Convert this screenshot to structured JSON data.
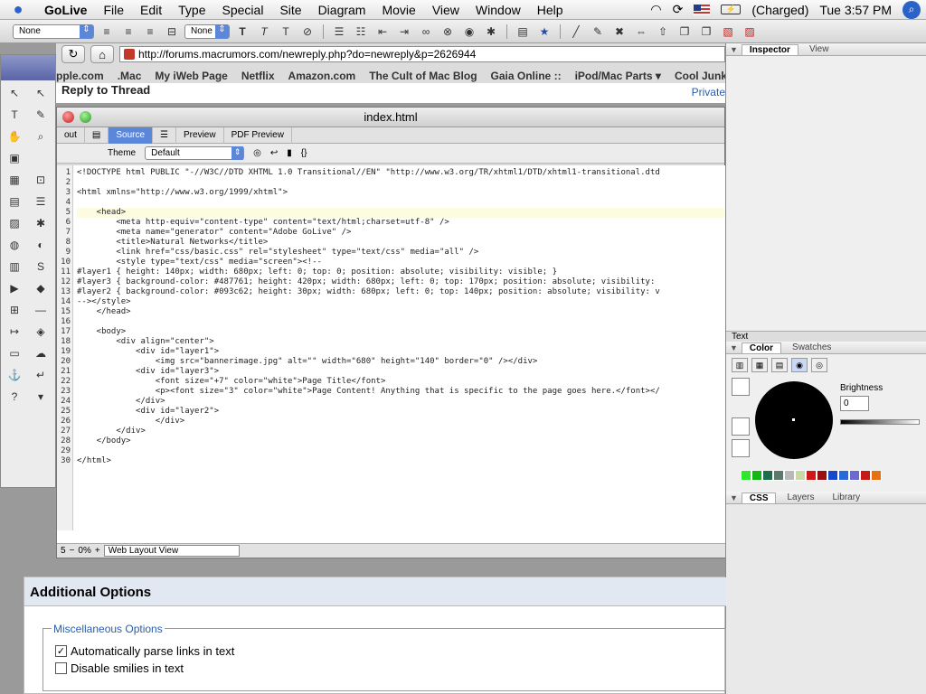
{
  "menubar": {
    "app_name": "GoLive",
    "items": [
      "File",
      "Edit",
      "Type",
      "Special",
      "Site",
      "Diagram",
      "Movie",
      "View",
      "Window",
      "Help"
    ],
    "battery_status": "(Charged)",
    "clock": "Tue 3:57 PM"
  },
  "toolbar": {
    "style_select": "None",
    "font_select": "None"
  },
  "browser": {
    "url": "http://forums.macrumors.com/newreply.php?do=newreply&p=2626944",
    "bookmarks": [
      "pple.com",
      ".Mac",
      "My iWeb Page",
      "Netflix",
      "Amazon.com",
      "The Cult of Mac Blog",
      "Gaia Online ::",
      "iPod/Mac Parts ▾",
      "Cool Junk ▾"
    ],
    "page_heading": "Reply to Thread",
    "private_tab": "Private"
  },
  "document": {
    "title": "index.html",
    "tabs": [
      "out",
      "Source",
      "Preview",
      "PDF Preview"
    ],
    "theme_label": "Theme",
    "theme_value": "Default",
    "braces_label": "{}",
    "line_numbers": [
      "1",
      "2",
      "3",
      "4",
      "5",
      "6",
      "7",
      "8",
      "9",
      "10",
      "11",
      "12",
      "13",
      "14",
      "15",
      "16",
      "17",
      "18",
      "19",
      "20",
      "21",
      "22",
      "23",
      "24",
      "25",
      "26",
      "27",
      "28",
      "29",
      "30"
    ],
    "code_lines": [
      "<!DOCTYPE html PUBLIC \"-//W3C//DTD XHTML 1.0 Transitional//EN\" \"http://www.w3.org/TR/xhtml1/DTD/xhtml1-transitional.dtd",
      "",
      "<html xmlns=\"http://www.w3.org/1999/xhtml\">",
      "",
      "    <head>",
      "        <meta http-equiv=\"content-type\" content=\"text/html;charset=utf-8\" />",
      "        <meta name=\"generator\" content=\"Adobe GoLive\" />",
      "        <title>Natural Networks</title>",
      "        <link href=\"css/basic.css\" rel=\"stylesheet\" type=\"text/css\" media=\"all\" />",
      "        <style type=\"text/css\" media=\"screen\"><!--",
      "#layer1 { height: 140px; width: 680px; left: 0; top: 0; position: absolute; visibility: visible; }",
      "#layer3 { background-color: #487761; height: 420px; width: 680px; left: 0; top: 170px; position: absolute; visibility:",
      "#layer2 { background-color: #093c62; height: 30px; width: 680px; left: 0; top: 140px; position: absolute; visibility: v",
      "--></style>",
      "    </head>",
      "",
      "    <body>",
      "        <div align=\"center\">",
      "            <div id=\"layer1\">",
      "                <img src=\"bannerimage.jpg\" alt=\"\" width=\"680\" height=\"140\" border=\"0\" /></div>",
      "            <div id=\"layer3\">",
      "                <font size=\"+7\" color=\"white\">Page Title</font>",
      "                <p><font size=\"3\" color=\"white\">Page Content! Anything that is specific to the page goes here.</font></",
      "            </div>",
      "            <div id=\"layer2\">",
      "                </div>",
      "        </div>",
      "    </body>",
      "",
      "</html>"
    ],
    "cursor_line": "5",
    "zoom": "0%",
    "view_mode": "Web Layout View"
  },
  "inspector": {
    "tabs": [
      "Inspector",
      "View"
    ],
    "text_label": "Text",
    "color_tabs": [
      "Color",
      "Swatches"
    ],
    "brightness_label": "Brightness",
    "brightness_value": "0",
    "css_tabs": [
      "CSS",
      "Layers",
      "Library"
    ],
    "swatch_colors": [
      "#2ee82e",
      "#14b814",
      "#1e6e4e",
      "#5a7a6a",
      "#b8b8b8",
      "#c8d8a8",
      "#d01818",
      "#9a1010",
      "#1848c8",
      "#2a6ad8",
      "#6a6ad0",
      "#c81818",
      "#e87010"
    ]
  },
  "page": {
    "section_title": "Additional Options",
    "fieldset_legend": "Miscellaneous Options",
    "option1_label": "Automatically parse links in text",
    "option1_checked": "✓",
    "option2_label": "Disable smilies in text"
  }
}
